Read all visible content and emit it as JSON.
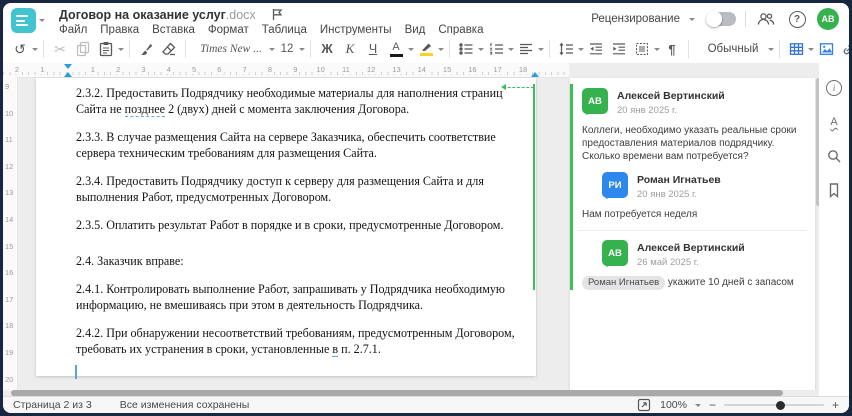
{
  "titlebar": {
    "doc_title": "Договор на оказание услуг",
    "doc_ext": ".docx",
    "review_label": "Рецензирование",
    "avatar_initials": "АВ"
  },
  "menu": {
    "items": [
      "Файл",
      "Правка",
      "Вставка",
      "Формат",
      "Таблица",
      "Инструменты",
      "Вид",
      "Справка"
    ]
  },
  "toolbar": {
    "undo_glyph": "↺",
    "cut_glyph": "✂",
    "font_name": "Times New ...",
    "font_size": "12",
    "bold": "Ж",
    "italic": "К",
    "underline": "Ч",
    "font_color_letter": "А",
    "pilcrow": "¶",
    "style_name": "Обычный",
    "more_glyph": "•••"
  },
  "header_icons": {
    "help_glyph": "?",
    "info_glyph": "i",
    "spellcheck_glyph": "А"
  },
  "ruler": {
    "h": [
      "2",
      "1",
      "",
      "1",
      "2",
      "3",
      "4",
      "5",
      "6",
      "7",
      "8",
      "9",
      "10",
      "11",
      "12",
      "13",
      "14",
      "15",
      "16",
      "17",
      "18"
    ],
    "v": [
      "9",
      "10",
      "11",
      "12",
      "13",
      "14",
      "15",
      "16",
      "17",
      "18",
      "19",
      "20"
    ]
  },
  "document": {
    "p232_a": "2.3.2. Предоставить Подрядчику необходимые материалы для наполнения страниц Сайта не ",
    "p232_marked": "позднее",
    "p232_b": " 2 (двух) дней с момента заключения Договора.",
    "p233": "2.3.3. В случае размещения Сайта на сервере Заказчика, обеспечить соответствие сервера техническим требованиям для размещения Сайта.",
    "p234": "2.3.4. Предоставить Подрядчику доступ к серверу для размещения Сайта и для выполнения Работ, предусмотренных Договором.",
    "p235": "2.3.5. Оплатить результат Работ в порядке и в сроки, предусмотренные Договором.",
    "p24": "2.4. Заказчик вправе:",
    "p241": "2.4.1. Контролировать выполнение Работ, запрашивать у Подрядчика необходимую информацию, не вмешиваясь при этом в деятельность Подрядчика.",
    "p242_a": "2.4.2. При обнаружении несоответствий требованиям, предусмотренным Договором, требовать их устранения в сроки, установленные ",
    "p242_marked": "в",
    "p242_b": " п. 2.7.1."
  },
  "comments": {
    "c1": {
      "initials": "АВ",
      "name": "Алексей Вертинский",
      "date": "20 янв 2025 г.",
      "text": "Коллеги, необходимо указать реальные сроки предоставления материалов подрядчику. Сколько времени вам потребуется?"
    },
    "c2": {
      "initials": "РИ",
      "name": "Роман Игнатьев",
      "date": "20 янв 2025 г.",
      "text": "Нам потребуется неделя"
    },
    "c3": {
      "initials": "АВ",
      "name": "Алексей Вертинский",
      "date": "26 май 2025 г.",
      "mention": "Роман Игнатьев",
      "text": " укажите 10 дней с запасом"
    }
  },
  "statusbar": {
    "page_info": "Страница 2 из 3",
    "saved_status": "Все изменения сохранены",
    "zoom_value": "100%"
  },
  "colors": {
    "accent_teal": "#41c4d0",
    "avatar_green": "#35b14e",
    "avatar_blue": "#2e87ec",
    "review_green": "#3cbd5e",
    "toolbar_blue": "#3474c9"
  }
}
